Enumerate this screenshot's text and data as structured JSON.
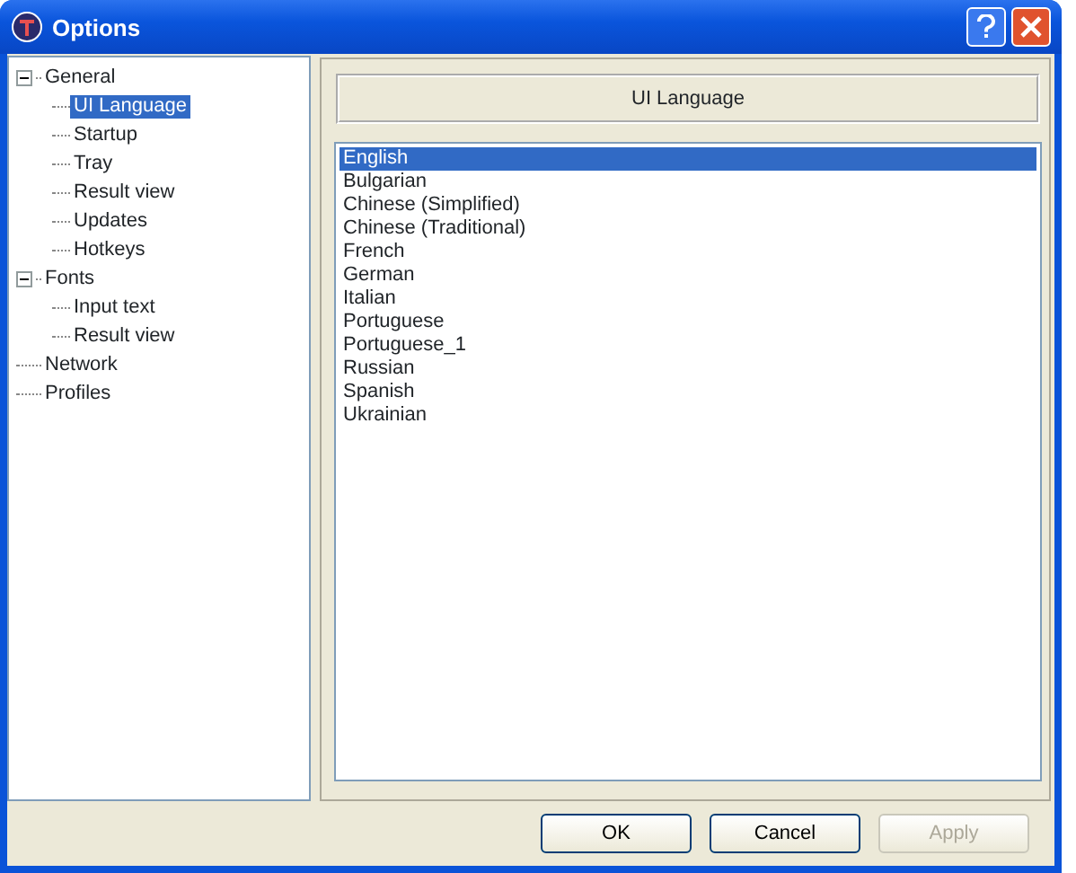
{
  "window": {
    "title": "Options"
  },
  "tree": [
    {
      "label": "General",
      "expanded": true,
      "selected": false,
      "children": [
        {
          "label": "UI Language",
          "selected": true
        },
        {
          "label": "Startup",
          "selected": false
        },
        {
          "label": "Tray",
          "selected": false
        },
        {
          "label": "Result view",
          "selected": false
        },
        {
          "label": "Updates",
          "selected": false
        },
        {
          "label": "Hotkeys",
          "selected": false
        }
      ]
    },
    {
      "label": "Fonts",
      "expanded": true,
      "selected": false,
      "children": [
        {
          "label": "Input text",
          "selected": false
        },
        {
          "label": "Result view",
          "selected": false
        }
      ]
    },
    {
      "label": "Network",
      "selected": false
    },
    {
      "label": "Profiles",
      "selected": false
    }
  ],
  "panel": {
    "heading": "UI Language"
  },
  "languages": [
    {
      "label": "English",
      "selected": true
    },
    {
      "label": "Bulgarian",
      "selected": false
    },
    {
      "label": "Chinese (Simplified)",
      "selected": false
    },
    {
      "label": "Chinese (Traditional)",
      "selected": false
    },
    {
      "label": "French",
      "selected": false
    },
    {
      "label": "German",
      "selected": false
    },
    {
      "label": "Italian",
      "selected": false
    },
    {
      "label": "Portuguese",
      "selected": false
    },
    {
      "label": "Portuguese_1",
      "selected": false
    },
    {
      "label": "Russian",
      "selected": false
    },
    {
      "label": "Spanish",
      "selected": false
    },
    {
      "label": "Ukrainian",
      "selected": false
    }
  ],
  "buttons": [
    {
      "label": "OK",
      "disabled": false
    },
    {
      "label": "Cancel",
      "disabled": false
    },
    {
      "label": "Apply",
      "disabled": true
    }
  ]
}
